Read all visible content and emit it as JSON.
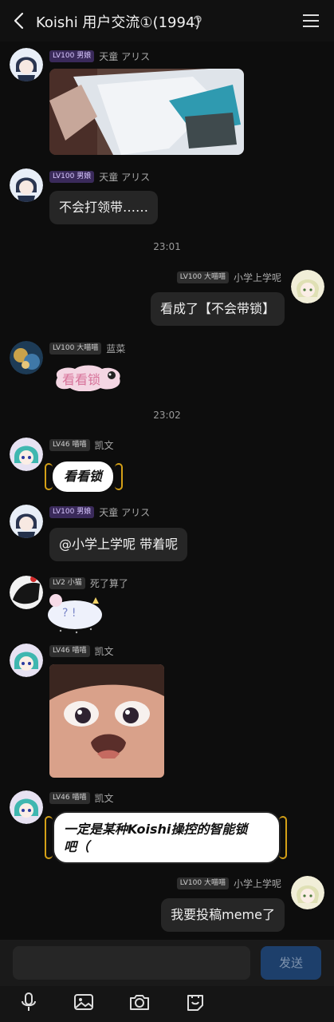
{
  "header": {
    "title": "Koishi 用户交流①(1994)"
  },
  "messages": [
    {
      "level": "LV100",
      "title": "男娘",
      "name": "天童 アリス",
      "type": "image"
    },
    {
      "level": "LV100",
      "title": "男娘",
      "name": "天童 アリス",
      "text": "不会打领带……"
    },
    {
      "time": "23:01"
    },
    {
      "level": "LV100",
      "title": "大喵喵",
      "name": "小学上学呢",
      "text": "看成了【不会带锁】",
      "self_side": true
    },
    {
      "level": "LV100",
      "title": "大喵喵",
      "name": "蓝菜",
      "sticker_text": "看看锁"
    },
    {
      "time": "23:02"
    },
    {
      "level": "LV46",
      "title": "喵喵",
      "name": "凯文",
      "sticker_text": "看看锁"
    },
    {
      "level": "LV100",
      "title": "男娘",
      "name": "天童 アリス",
      "text": "@小学上学呢 带着呢"
    },
    {
      "level": "LV2",
      "title": "小猫",
      "name": "死了算了",
      "sticker_text": "? !"
    },
    {
      "level": "LV46",
      "title": "喵喵",
      "name": "凯文",
      "type": "image"
    },
    {
      "level": "LV46",
      "title": "喵喵",
      "name": "凯文",
      "sticker_text_lines": [
        "一定是某种Koishi操控的智能锁",
        "吧（"
      ]
    },
    {
      "level": "LV100",
      "title": "大喵喵",
      "name": "小学上学呢",
      "text": "我要投稿meme了",
      "self_side": true
    }
  ],
  "input": {
    "send_label": "发送"
  },
  "toolbar": {
    "icons": [
      "microphone-icon",
      "image-icon",
      "camera-icon",
      "sticker-icon"
    ]
  },
  "colors": {
    "background": "#0d0d0d",
    "bubble": "#262626",
    "send_button": "#1d3f6b",
    "badge_purple": "#3a2a5a"
  }
}
